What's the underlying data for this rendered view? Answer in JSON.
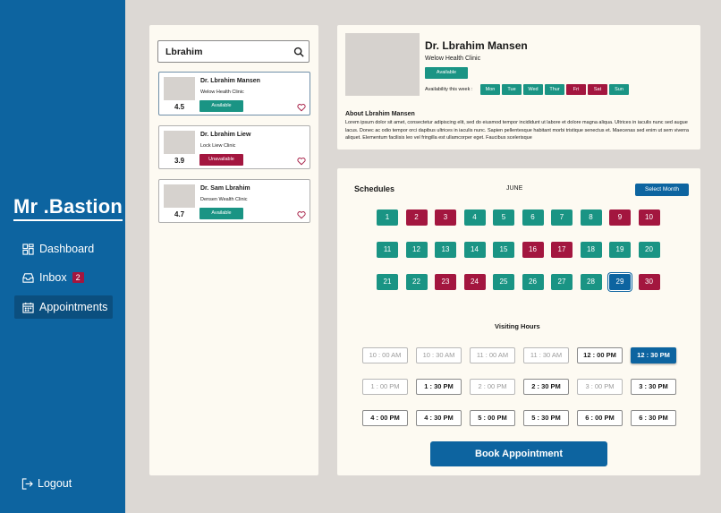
{
  "sidebar": {
    "brand": "Mr .Bastion",
    "nav": [
      {
        "label": "Dashboard",
        "icon": "dashboard-icon"
      },
      {
        "label": "Inbox",
        "icon": "inbox-icon",
        "badge": "2"
      },
      {
        "label": "Appointments",
        "icon": "calendar-icon",
        "active": true
      }
    ],
    "logout": "Logout"
  },
  "search": {
    "value": "Lbrahim"
  },
  "doctors": [
    {
      "name": "Dr. Lbrahim Mansen",
      "clinic": "Welow Health Clinic",
      "rating": "4.5",
      "status": "Available"
    },
    {
      "name": "Dr. Lbrahim Liew",
      "clinic": "Lock Liew  Clinic",
      "rating": "3.9",
      "status": "Unavailable"
    },
    {
      "name": "Dr. Sam Lbrahim",
      "clinic": "Densen Wealth Clinic",
      "rating": "4.7",
      "status": "Available"
    }
  ],
  "profile": {
    "name": "Dr. Lbrahim Mansen",
    "clinic": "Welow Health Clinic",
    "status": "Available",
    "availability_label": "Availability this week :",
    "days": [
      {
        "label": "Mon",
        "available": true
      },
      {
        "label": "Tue",
        "available": true
      },
      {
        "label": "Wed",
        "available": true
      },
      {
        "label": "Thur",
        "available": true
      },
      {
        "label": "Fri",
        "available": false
      },
      {
        "label": "Sat",
        "available": false
      },
      {
        "label": "Sun",
        "available": true
      }
    ],
    "about_title": "About Lbrahim Mansen",
    "about_text": "Lorem ipsum dolor sit amet, consectetur adipiscing elit, sed do eiusmod tempor incididunt ut labore et dolore magna aliqua. Ultrices in iaculis nunc sed augue lacus. Donec ac odio tempor orci dapibus ultrices in iaculis nunc. Sapien pellentesque habitant morbi tristique senectus et. Maecenas sed enim ut sem viverra aliquet. Elementum facilisis leo vel fringilla est ullamcorper eget. Faucibus scelerisque"
  },
  "schedule": {
    "title": "Schedules",
    "month": "JUNE",
    "select_month": "Select Month",
    "selected_date": 29,
    "dates": [
      {
        "d": 1,
        "available": true
      },
      {
        "d": 2,
        "available": false
      },
      {
        "d": 3,
        "available": false
      },
      {
        "d": 4,
        "available": true
      },
      {
        "d": 5,
        "available": true
      },
      {
        "d": 6,
        "available": true
      },
      {
        "d": 7,
        "available": true
      },
      {
        "d": 8,
        "available": true
      },
      {
        "d": 9,
        "available": false
      },
      {
        "d": 10,
        "available": false
      },
      {
        "d": 11,
        "available": true
      },
      {
        "d": 12,
        "available": true
      },
      {
        "d": 13,
        "available": true
      },
      {
        "d": 14,
        "available": true
      },
      {
        "d": 15,
        "available": true
      },
      {
        "d": 16,
        "available": false
      },
      {
        "d": 17,
        "available": false
      },
      {
        "d": 18,
        "available": true
      },
      {
        "d": 19,
        "available": true
      },
      {
        "d": 20,
        "available": true
      },
      {
        "d": 21,
        "available": true
      },
      {
        "d": 22,
        "available": true
      },
      {
        "d": 23,
        "available": false
      },
      {
        "d": 24,
        "available": false
      },
      {
        "d": 25,
        "available": true
      },
      {
        "d": 26,
        "available": true
      },
      {
        "d": 27,
        "available": true
      },
      {
        "d": 28,
        "available": true
      },
      {
        "d": 29,
        "available": true
      },
      {
        "d": 30,
        "available": false
      }
    ],
    "visiting_title": "Visiting Hours",
    "times": [
      {
        "t": "10 : 00 AM",
        "state": "disabled"
      },
      {
        "t": "10 : 30 AM",
        "state": "disabled"
      },
      {
        "t": "11 : 00 AM",
        "state": "disabled"
      },
      {
        "t": "11 : 30 AM",
        "state": "disabled"
      },
      {
        "t": "12 : 00 PM",
        "state": "available"
      },
      {
        "t": "12 : 30 PM",
        "state": "selected"
      },
      {
        "t": "1 : 00 PM",
        "state": "disabled"
      },
      {
        "t": "1 : 30 PM",
        "state": "available"
      },
      {
        "t": "2 : 00 PM",
        "state": "disabled"
      },
      {
        "t": "2 : 30 PM",
        "state": "available"
      },
      {
        "t": "3 : 00 PM",
        "state": "disabled"
      },
      {
        "t": "3 : 30 PM",
        "state": "available"
      },
      {
        "t": "4 : 00 PM",
        "state": "available"
      },
      {
        "t": "4 : 30 PM",
        "state": "available"
      },
      {
        "t": "5 : 00 PM",
        "state": "available"
      },
      {
        "t": "5 : 30 PM",
        "state": "available"
      },
      {
        "t": "6 : 00 PM",
        "state": "available"
      },
      {
        "t": "6 : 30 PM",
        "state": "available"
      }
    ],
    "book_label": "Book Appointment"
  },
  "colors": {
    "primary": "#0d64a0",
    "available": "#1a9484",
    "unavailable": "#a3163f",
    "panel": "#fdfaf2",
    "background": "#dcd8d4"
  }
}
